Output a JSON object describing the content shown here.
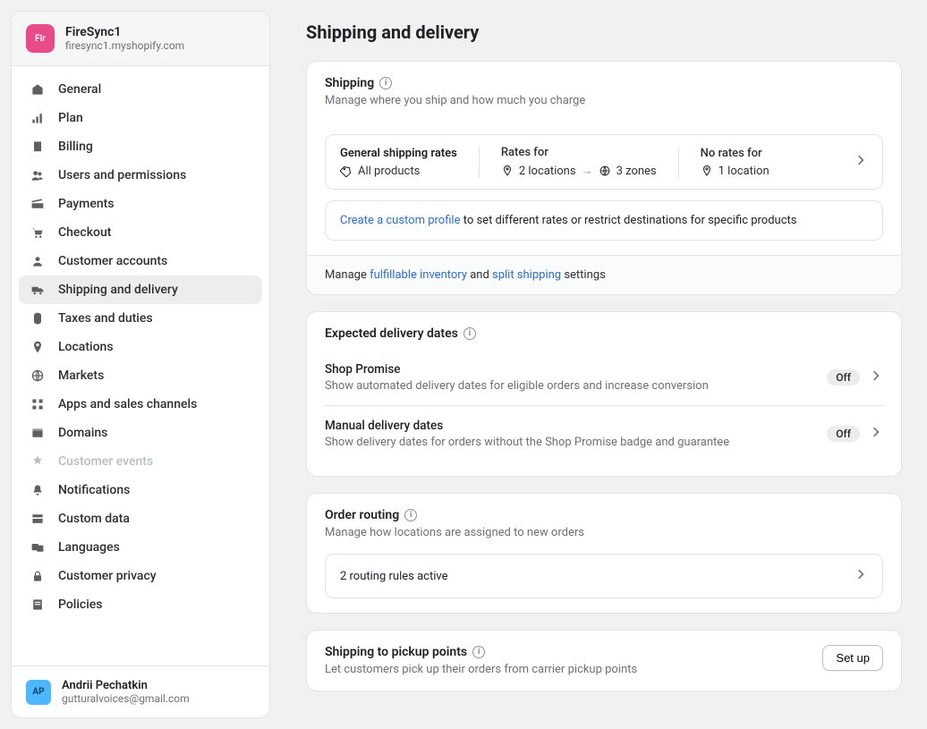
{
  "store": {
    "badge": "Flr",
    "name": "FireSync1",
    "domain": "firesync1.myshopify.com"
  },
  "nav": {
    "items": [
      {
        "label": "General",
        "icon": "home"
      },
      {
        "label": "Plan",
        "icon": "plan"
      },
      {
        "label": "Billing",
        "icon": "billing"
      },
      {
        "label": "Users and permissions",
        "icon": "users"
      },
      {
        "label": "Payments",
        "icon": "payments"
      },
      {
        "label": "Checkout",
        "icon": "checkout"
      },
      {
        "label": "Customer accounts",
        "icon": "customer"
      },
      {
        "label": "Shipping and delivery",
        "icon": "shipping",
        "active": true
      },
      {
        "label": "Taxes and duties",
        "icon": "taxes"
      },
      {
        "label": "Locations",
        "icon": "locations"
      },
      {
        "label": "Markets",
        "icon": "markets"
      },
      {
        "label": "Apps and sales channels",
        "icon": "apps"
      },
      {
        "label": "Domains",
        "icon": "domains"
      },
      {
        "label": "Customer events",
        "icon": "events",
        "disabled": true
      },
      {
        "label": "Notifications",
        "icon": "notifications"
      },
      {
        "label": "Custom data",
        "icon": "customdata"
      },
      {
        "label": "Languages",
        "icon": "languages"
      },
      {
        "label": "Customer privacy",
        "icon": "privacy"
      },
      {
        "label": "Policies",
        "icon": "policies"
      }
    ]
  },
  "user": {
    "badge": "AP",
    "name": "Andrii Pechatkin",
    "email": "gutturalvoices@gmail.com"
  },
  "page": {
    "title": "Shipping and delivery"
  },
  "shipping": {
    "title": "Shipping",
    "subtitle": "Manage where you ship and how much you charge",
    "general_label": "General shipping rates",
    "all_products": "All products",
    "rates_for_label": "Rates for",
    "locations": "2 locations",
    "zones": "3 zones",
    "no_rates_label": "No rates for",
    "no_rates_locations": "1 location",
    "custom_profile_link": "Create a custom profile",
    "custom_profile_rest": " to set different rates or restrict destinations for specific products",
    "manage_prefix": "Manage ",
    "fulfillable_link": "fulfillable inventory",
    "and": " and ",
    "split_link": "split shipping",
    "settings_suffix": " settings"
  },
  "expected": {
    "title": "Expected delivery dates",
    "shop_promise_title": "Shop Promise",
    "shop_promise_sub": "Show automated delivery dates for eligible orders and increase conversion",
    "shop_promise_badge": "Off",
    "manual_title": "Manual delivery dates",
    "manual_sub": "Show delivery dates for orders without the Shop Promise badge and guarantee",
    "manual_badge": "Off"
  },
  "routing": {
    "title": "Order routing",
    "subtitle": "Manage how locations are assigned to new orders",
    "rules": "2 routing rules active"
  },
  "pickup": {
    "title": "Shipping to pickup points",
    "subtitle": "Let customers pick up their orders from carrier pickup points",
    "button": "Set up"
  }
}
